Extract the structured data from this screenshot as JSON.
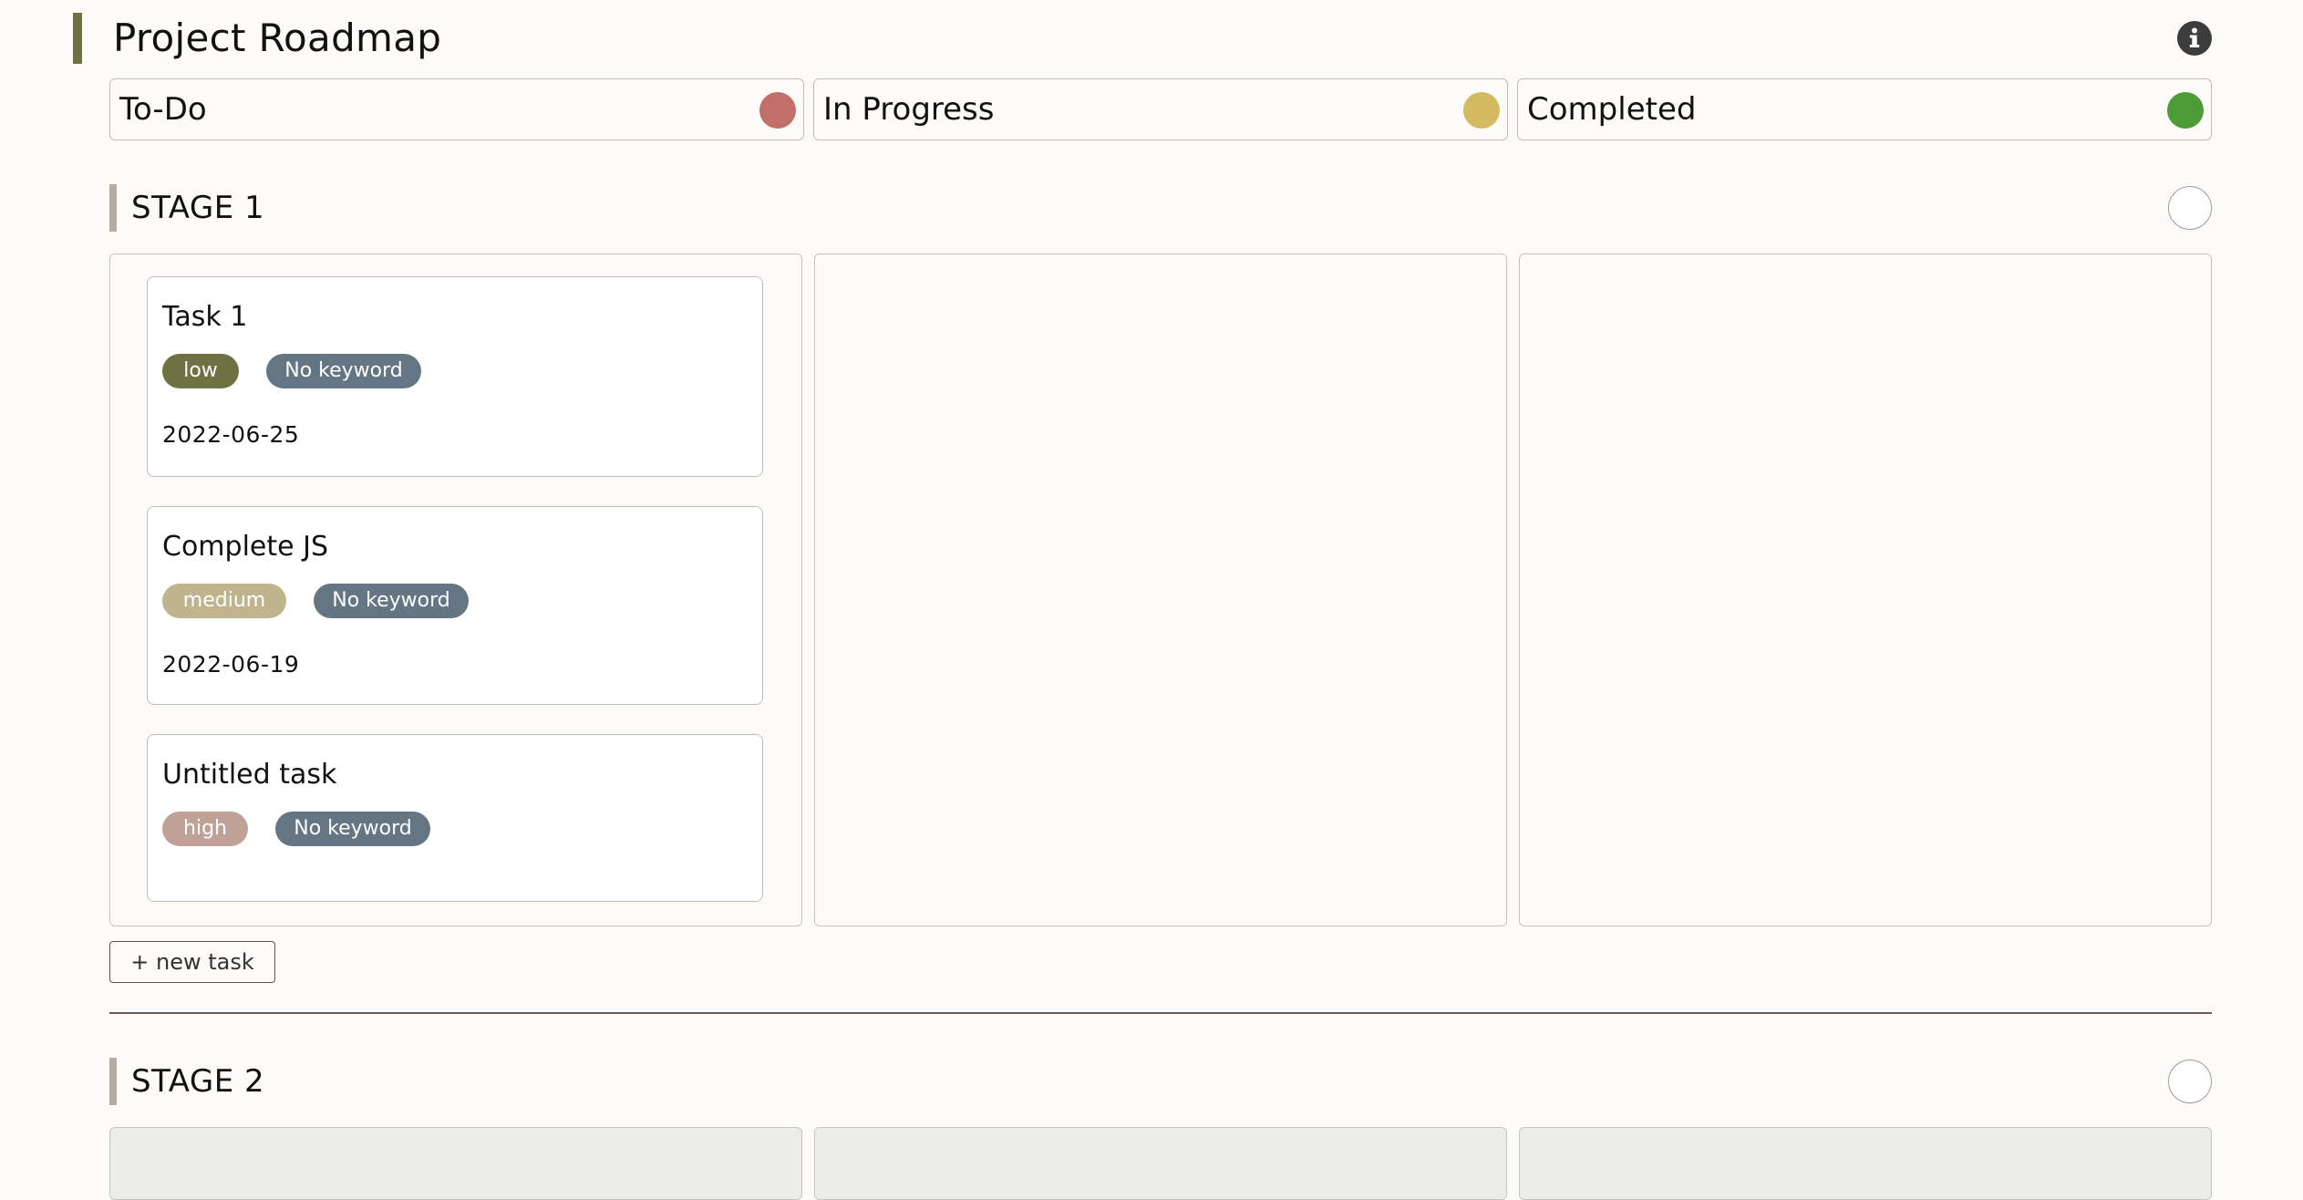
{
  "header": {
    "title": "Project Roadmap",
    "info_icon": "info-icon"
  },
  "statuses": [
    {
      "label": "To-Do",
      "color": "#c26e69"
    },
    {
      "label": "In Progress",
      "color": "#d3b960"
    },
    {
      "label": "Completed",
      "color": "#4b9c37"
    }
  ],
  "stages": [
    {
      "title": "STAGE 1",
      "columns": [
        {
          "tasks": [
            {
              "title": "Task 1",
              "priority": "low",
              "priority_color": "#6e7142",
              "keyword": "No keyword",
              "keyword_color": "#647584",
              "date": "2022-06-25"
            },
            {
              "title": "Complete JS",
              "priority": "medium",
              "priority_color": "#bfb48e",
              "keyword": "No keyword",
              "keyword_color": "#647584",
              "date": "2022-06-19"
            },
            {
              "title": "Untitled task",
              "priority": "high",
              "priority_color": "#c0a196",
              "keyword": "No keyword",
              "keyword_color": "#647584",
              "date": ""
            }
          ]
        },
        {
          "tasks": []
        },
        {
          "tasks": []
        }
      ],
      "new_task_label": "+ new task"
    },
    {
      "title": "STAGE 2"
    }
  ],
  "colors": {
    "background": "#fdfbf8",
    "accent": "#6e7142",
    "stage_bar": "#b8aaa0",
    "divider": "#6b5a52"
  }
}
